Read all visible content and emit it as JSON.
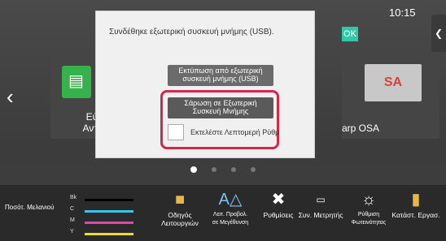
{
  "status": {
    "time": "10:15"
  },
  "tiles": [
    {
      "label_line1": "Εύκολ",
      "label_line2": "Αντιγρα"
    },
    {
      "label": "arp OSA",
      "icon_text": "SA"
    }
  ],
  "dialog": {
    "message": "Συνδέθηκε εξωτερική συσκευή μνήμης (USB).",
    "ok": "OK",
    "print_btn": {
      "line1": "Εκτύπωση από εξωτερική",
      "line2": "συσκευή μνήμης (USB)"
    },
    "scan_btn": {
      "line1": "Σάρωση σε Εξωτερική",
      "line2": "Συσκευή Μνήμης"
    },
    "detail_checkbox": "Εκτελέστε Λεπτομερή Ρύθμ"
  },
  "toner": {
    "label": "Ποσότ. Μελανιού",
    "levels": [
      {
        "name": "Bk",
        "color": "#000000"
      },
      {
        "name": "C",
        "color": "#35c6e8"
      },
      {
        "name": "M",
        "color": "#d94aa5"
      },
      {
        "name": "Y",
        "color": "#e9dd2c"
      }
    ]
  },
  "bottom_buttons": [
    {
      "line1": "Οδηγός",
      "line2": "Λειτουργιών",
      "icon": "operation-guide-icon"
    },
    {
      "line1": "Λειτ. Προβολ.",
      "line2": "σε Μεγέθυνση",
      "icon": "font-size-icon"
    },
    {
      "line1": "Ρυθμίσεις",
      "line2": "",
      "icon": "settings-tools-icon"
    },
    {
      "line1": "Συν. Μετρητής",
      "line2": "",
      "icon": "counter-icon"
    },
    {
      "line1": "Ρύθμιση",
      "line2": "Φωτεινότητας",
      "icon": "brightness-icon"
    },
    {
      "line1": "Κατάστ. Εργασ.",
      "line2": "",
      "icon": "job-status-icon"
    }
  ]
}
